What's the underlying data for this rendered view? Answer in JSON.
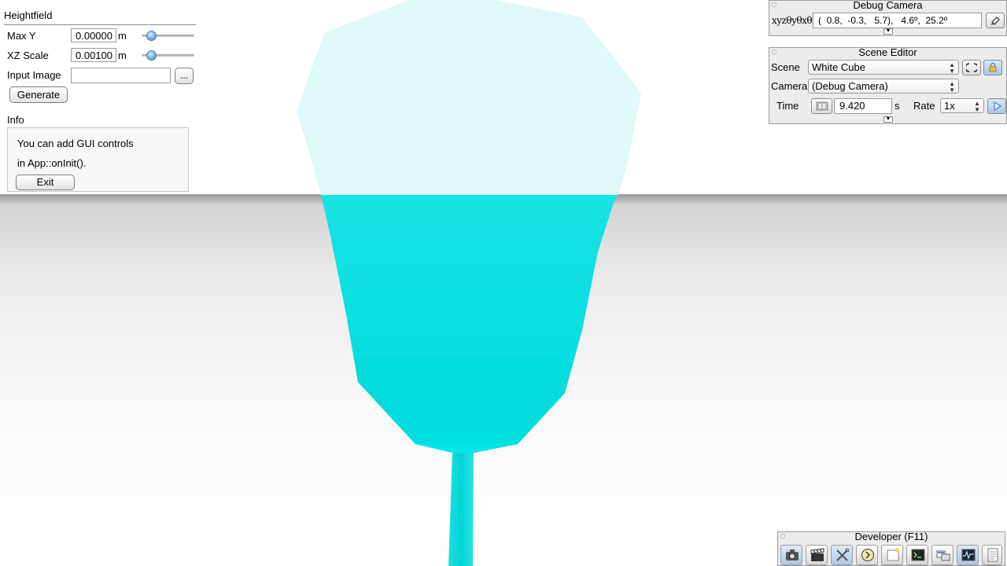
{
  "heightfield": {
    "title": "Heightfield",
    "max_y": {
      "label": "Max Y",
      "value": "0.00000",
      "unit": "m",
      "slider_fraction": 0.12
    },
    "xz_scale": {
      "label": "XZ Scale",
      "value": "0.00100",
      "unit": "m",
      "slider_fraction": 0.12
    },
    "input_image": {
      "label": "Input Image",
      "value": "",
      "browse_label": "..."
    },
    "generate_label": "Generate",
    "info": {
      "label": "Info",
      "line1": "You can add GUI controls",
      "line2": "in App::onInit().",
      "exit_label": "Exit"
    }
  },
  "debug_camera": {
    "title": "Debug Camera",
    "coord_label": "xyzθyθxθz",
    "coord_value": "(  0.8,  -0.3,   5.7),   4.6º,  25.2º"
  },
  "scene_editor": {
    "title": "Scene Editor",
    "scene_label": "Scene",
    "scene_value": "White Cube",
    "camera_label": "Camera",
    "camera_value": "(Debug Camera)",
    "time_label": "Time",
    "time_value": "9.420",
    "time_unit": "s",
    "rate_label": "Rate",
    "rate_value": "1x"
  },
  "developer": {
    "title": "Developer (F11)",
    "buttons": [
      "camera-icon",
      "clapperboard-icon",
      "tools-icon",
      "clock-icon",
      "window-icon",
      "terminal-icon",
      "scene-graph-icon",
      "profiler-icon",
      "document-icon"
    ]
  },
  "colors": {
    "object": "#00e6e6",
    "object_light": "#dcfbfb",
    "accent": "#4a88d8"
  }
}
